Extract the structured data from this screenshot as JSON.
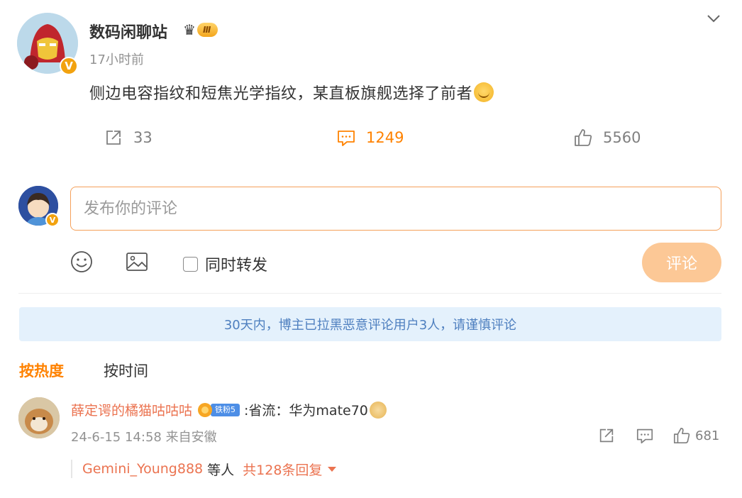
{
  "post": {
    "author": "数码闲聊站",
    "author_level": "Ⅲ",
    "verified_mark": "V",
    "time": "17小时前",
    "text": "侧边电容指纹和短焦光学指纹，某直板旗舰选择了前者",
    "text_emoji": "smile-emoji",
    "forward_count": "33",
    "comment_count": "1249",
    "like_count": "5560",
    "accent_color": "#ff8200"
  },
  "compose": {
    "placeholder": "发布你的评论",
    "verified_mark": "V",
    "repost_label": "同时转发",
    "submit_label": "评论"
  },
  "notice": "30天内，博主已拉黑恶意评论用户3人，请谨慎评论",
  "sort": {
    "hot_label": "按热度",
    "time_label": "按时间"
  },
  "comments": [
    {
      "user": "薛定谔的橘猫咕咕咕",
      "fan_badge": "铁粉5",
      "text": ":省流：华为mate70",
      "date": "24-6-15 14:58",
      "location": "来自安徽",
      "like_count": "681",
      "reply": {
        "user": "Gemini_Young888",
        "etc": "等人",
        "total": "共128条回复"
      }
    }
  ],
  "colors": {
    "username": "#eb7350",
    "notice_bg": "#e4f1fc",
    "notice_text": "#4e7fbf",
    "submit_bg": "#fcc896"
  }
}
